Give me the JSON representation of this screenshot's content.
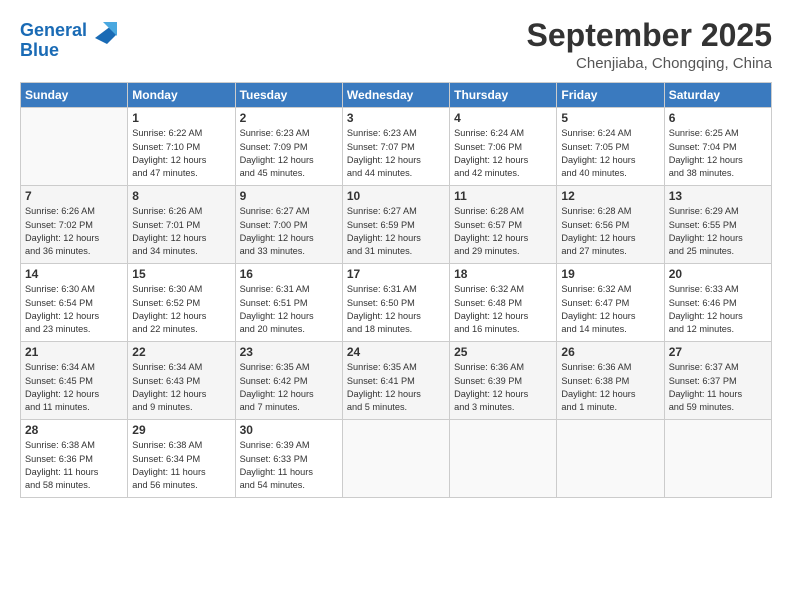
{
  "logo": {
    "line1": "General",
    "line2": "Blue"
  },
  "title": "September 2025",
  "location": "Chenjiaba, Chongqing, China",
  "weekdays": [
    "Sunday",
    "Monday",
    "Tuesday",
    "Wednesday",
    "Thursday",
    "Friday",
    "Saturday"
  ],
  "weeks": [
    [
      {
        "day": "",
        "info": ""
      },
      {
        "day": "1",
        "info": "Sunrise: 6:22 AM\nSunset: 7:10 PM\nDaylight: 12 hours\nand 47 minutes."
      },
      {
        "day": "2",
        "info": "Sunrise: 6:23 AM\nSunset: 7:09 PM\nDaylight: 12 hours\nand 45 minutes."
      },
      {
        "day": "3",
        "info": "Sunrise: 6:23 AM\nSunset: 7:07 PM\nDaylight: 12 hours\nand 44 minutes."
      },
      {
        "day": "4",
        "info": "Sunrise: 6:24 AM\nSunset: 7:06 PM\nDaylight: 12 hours\nand 42 minutes."
      },
      {
        "day": "5",
        "info": "Sunrise: 6:24 AM\nSunset: 7:05 PM\nDaylight: 12 hours\nand 40 minutes."
      },
      {
        "day": "6",
        "info": "Sunrise: 6:25 AM\nSunset: 7:04 PM\nDaylight: 12 hours\nand 38 minutes."
      }
    ],
    [
      {
        "day": "7",
        "info": "Sunrise: 6:26 AM\nSunset: 7:02 PM\nDaylight: 12 hours\nand 36 minutes."
      },
      {
        "day": "8",
        "info": "Sunrise: 6:26 AM\nSunset: 7:01 PM\nDaylight: 12 hours\nand 34 minutes."
      },
      {
        "day": "9",
        "info": "Sunrise: 6:27 AM\nSunset: 7:00 PM\nDaylight: 12 hours\nand 33 minutes."
      },
      {
        "day": "10",
        "info": "Sunrise: 6:27 AM\nSunset: 6:59 PM\nDaylight: 12 hours\nand 31 minutes."
      },
      {
        "day": "11",
        "info": "Sunrise: 6:28 AM\nSunset: 6:57 PM\nDaylight: 12 hours\nand 29 minutes."
      },
      {
        "day": "12",
        "info": "Sunrise: 6:28 AM\nSunset: 6:56 PM\nDaylight: 12 hours\nand 27 minutes."
      },
      {
        "day": "13",
        "info": "Sunrise: 6:29 AM\nSunset: 6:55 PM\nDaylight: 12 hours\nand 25 minutes."
      }
    ],
    [
      {
        "day": "14",
        "info": "Sunrise: 6:30 AM\nSunset: 6:54 PM\nDaylight: 12 hours\nand 23 minutes."
      },
      {
        "day": "15",
        "info": "Sunrise: 6:30 AM\nSunset: 6:52 PM\nDaylight: 12 hours\nand 22 minutes."
      },
      {
        "day": "16",
        "info": "Sunrise: 6:31 AM\nSunset: 6:51 PM\nDaylight: 12 hours\nand 20 minutes."
      },
      {
        "day": "17",
        "info": "Sunrise: 6:31 AM\nSunset: 6:50 PM\nDaylight: 12 hours\nand 18 minutes."
      },
      {
        "day": "18",
        "info": "Sunrise: 6:32 AM\nSunset: 6:48 PM\nDaylight: 12 hours\nand 16 minutes."
      },
      {
        "day": "19",
        "info": "Sunrise: 6:32 AM\nSunset: 6:47 PM\nDaylight: 12 hours\nand 14 minutes."
      },
      {
        "day": "20",
        "info": "Sunrise: 6:33 AM\nSunset: 6:46 PM\nDaylight: 12 hours\nand 12 minutes."
      }
    ],
    [
      {
        "day": "21",
        "info": "Sunrise: 6:34 AM\nSunset: 6:45 PM\nDaylight: 12 hours\nand 11 minutes."
      },
      {
        "day": "22",
        "info": "Sunrise: 6:34 AM\nSunset: 6:43 PM\nDaylight: 12 hours\nand 9 minutes."
      },
      {
        "day": "23",
        "info": "Sunrise: 6:35 AM\nSunset: 6:42 PM\nDaylight: 12 hours\nand 7 minutes."
      },
      {
        "day": "24",
        "info": "Sunrise: 6:35 AM\nSunset: 6:41 PM\nDaylight: 12 hours\nand 5 minutes."
      },
      {
        "day": "25",
        "info": "Sunrise: 6:36 AM\nSunset: 6:39 PM\nDaylight: 12 hours\nand 3 minutes."
      },
      {
        "day": "26",
        "info": "Sunrise: 6:36 AM\nSunset: 6:38 PM\nDaylight: 12 hours\nand 1 minute."
      },
      {
        "day": "27",
        "info": "Sunrise: 6:37 AM\nSunset: 6:37 PM\nDaylight: 11 hours\nand 59 minutes."
      }
    ],
    [
      {
        "day": "28",
        "info": "Sunrise: 6:38 AM\nSunset: 6:36 PM\nDaylight: 11 hours\nand 58 minutes."
      },
      {
        "day": "29",
        "info": "Sunrise: 6:38 AM\nSunset: 6:34 PM\nDaylight: 11 hours\nand 56 minutes."
      },
      {
        "day": "30",
        "info": "Sunrise: 6:39 AM\nSunset: 6:33 PM\nDaylight: 11 hours\nand 54 minutes."
      },
      {
        "day": "",
        "info": ""
      },
      {
        "day": "",
        "info": ""
      },
      {
        "day": "",
        "info": ""
      },
      {
        "day": "",
        "info": ""
      }
    ]
  ]
}
